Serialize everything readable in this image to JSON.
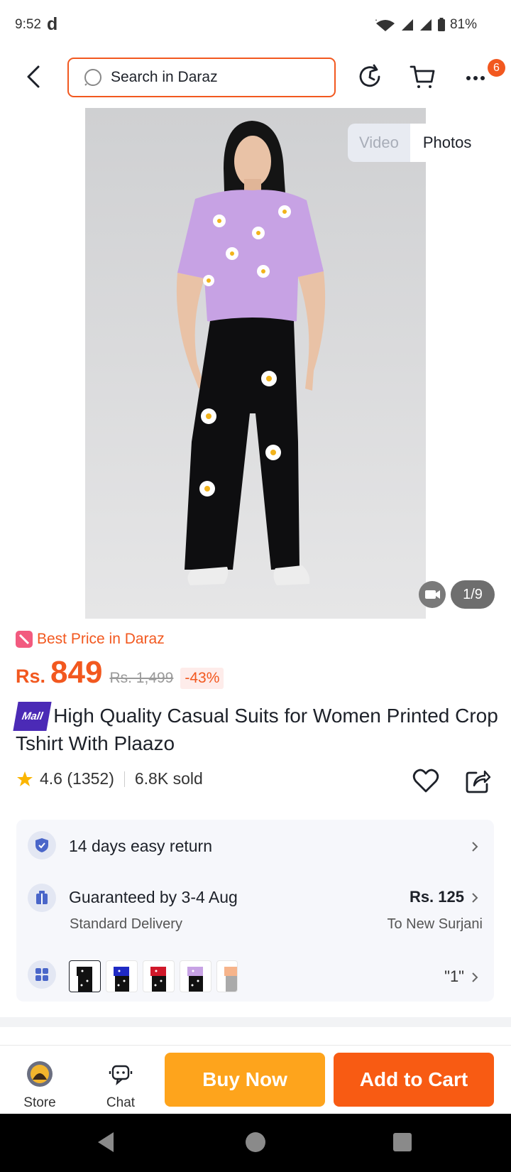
{
  "status_bar": {
    "time": "9:52",
    "app_logo": "d",
    "battery": "81%"
  },
  "header": {
    "search_placeholder": "Search in Daraz",
    "cart_badge": "6"
  },
  "gallery": {
    "video_label": "Video",
    "photos_label": "Photos",
    "counter": "1/9"
  },
  "product": {
    "best_price_label": "Best Price in Daraz",
    "currency": "Rs.",
    "price": "849",
    "original_price": "Rs. 1,499",
    "discount": "-43%",
    "mall_badge": "Mall",
    "title": "High Quality Casual Suits for Women Printed Crop Tshirt With Plaazo",
    "rating": "4.6",
    "rating_count": "(1352)",
    "sold": "6.8K sold"
  },
  "info": {
    "return_text": "14 days easy return",
    "delivery_text": "Guaranteed by 3-4 Aug",
    "delivery_sub": "Standard Delivery",
    "delivery_price": "Rs. 125",
    "delivery_location": "To New Surjani",
    "selected_option": "\"1\""
  },
  "colors": {
    "brand": "#f2581f",
    "buy_now": "#fea41c",
    "add_to_cart": "#f85b13"
  },
  "bottom_bar": {
    "store_label": "Store",
    "chat_label": "Chat",
    "buy_now_label": "Buy Now",
    "add_to_cart_label": "Add to Cart"
  }
}
